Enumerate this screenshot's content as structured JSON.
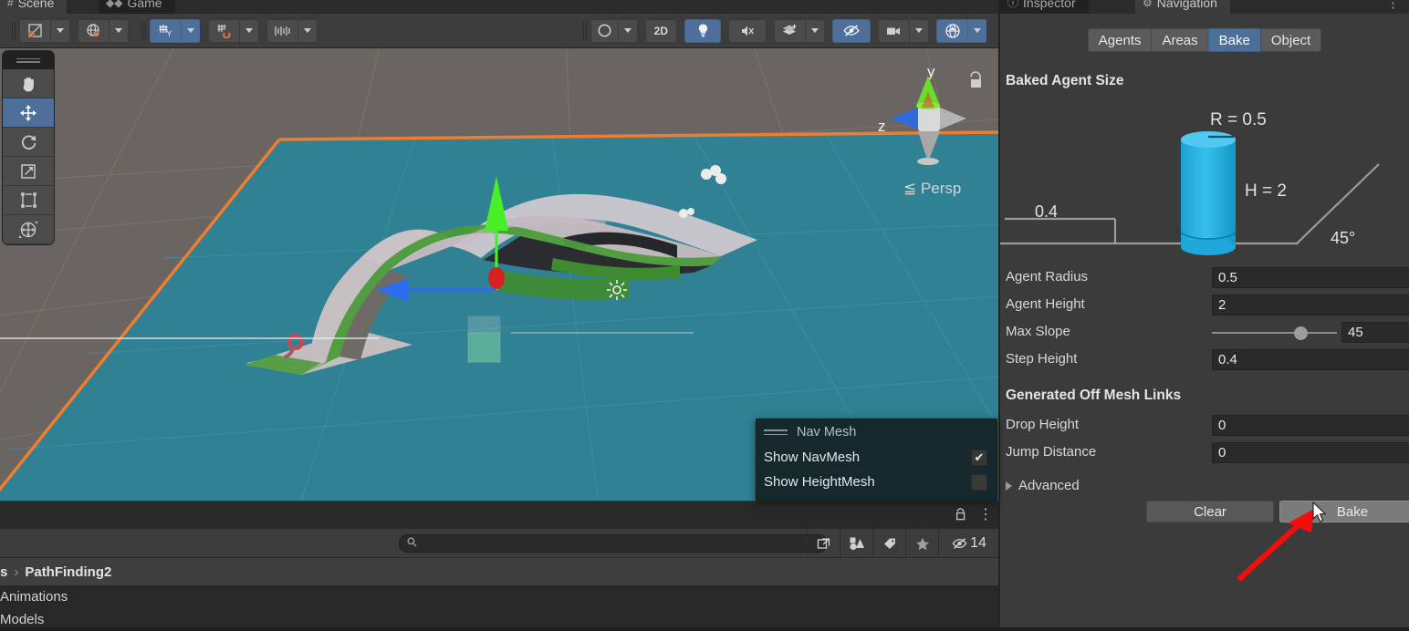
{
  "scene_panel": {
    "tabs": [
      {
        "label": "Scene",
        "icon": "grid-hash-icon",
        "active": true
      },
      {
        "label": "Game",
        "icon": "gamepad-icon",
        "active": false
      }
    ],
    "toolbar": {
      "groups": [
        {
          "items": [
            {
              "name": "pivot-rotation-icon",
              "glyph": "square-slash",
              "active": false,
              "dropdown": true
            },
            {
              "name": "pivot-center-icon",
              "glyph": "globe",
              "active": false,
              "dropdown": true
            }
          ]
        },
        {
          "items": [
            {
              "name": "grid-snapping-icon",
              "glyph": "grid-y",
              "active": true,
              "dropdown": true
            },
            {
              "name": "vertex-snapping-icon",
              "glyph": "grid-magnet",
              "active": false,
              "dropdown": true
            },
            {
              "name": "increment-snapping-icon",
              "glyph": "ruler",
              "active": false,
              "dropdown": true
            }
          ]
        }
      ],
      "right_items": [
        {
          "name": "shading-mode-icon",
          "glyph": "sphere",
          "active": false,
          "dropdown": true
        },
        {
          "name": "toggle-2d-button",
          "label": "2D",
          "active": false
        },
        {
          "name": "scene-lighting-icon",
          "glyph": "bulb",
          "active": true
        },
        {
          "name": "scene-audio-icon",
          "glyph": "speaker-mute",
          "active": false
        },
        {
          "name": "scene-fx-icon",
          "glyph": "layers-fx",
          "active": false,
          "dropdown": true
        },
        {
          "name": "scene-visibility-icon",
          "glyph": "eye-slash",
          "active": true
        },
        {
          "name": "scene-camera-icon",
          "glyph": "camera",
          "active": false,
          "dropdown": true
        },
        {
          "name": "gizmos-toggle-icon",
          "glyph": "gizmo",
          "active": true,
          "dropdown": true
        }
      ]
    },
    "tool_palette": [
      {
        "name": "hand-tool",
        "glyph": "hand",
        "active": false
      },
      {
        "name": "move-tool",
        "glyph": "move-arrows",
        "active": true
      },
      {
        "name": "rotate-tool",
        "glyph": "rotate",
        "active": false
      },
      {
        "name": "scale-tool",
        "glyph": "scale",
        "active": false
      },
      {
        "name": "rect-tool",
        "glyph": "rect",
        "active": false
      },
      {
        "name": "transform-tool",
        "glyph": "transform",
        "active": false
      }
    ],
    "gizmo": {
      "axis_y_label": "y",
      "axis_z_label": "z",
      "projection_label": "Persp",
      "projection_prefix": "≤",
      "lock_icon": "padlock-icon"
    },
    "navmesh_popup": {
      "title": "Nav Mesh",
      "rows": [
        {
          "label": "Show NavMesh",
          "checked": true
        },
        {
          "label": "Show HeightMesh",
          "checked": false
        }
      ]
    },
    "colors": {
      "navmesh_teal": "#2f8193",
      "selection_orange": "#f07d2e",
      "walkable_green": "#4c9a3a",
      "ground_gray": "#6a6560",
      "axis_y_green": "#49ef26",
      "axis_x_blue": "#2c6df0",
      "axis_z_red": "#d62121"
    }
  },
  "project_panel": {
    "lock_icon": "padlock-icon",
    "kebab_icon": "kebab-menu-icon",
    "search": {
      "placeholder": "",
      "value": "",
      "icon": "search-icon"
    },
    "toolbar_buttons": [
      {
        "name": "open-search-window-icon",
        "glyph": "open-window"
      },
      {
        "name": "filter-by-type-icon",
        "glyph": "shapes"
      },
      {
        "name": "filter-by-label-icon",
        "glyph": "tag"
      },
      {
        "name": "favorites-icon",
        "glyph": "star"
      },
      {
        "name": "hidden-count-icon",
        "glyph": "eye-slash",
        "count": "14"
      }
    ],
    "breadcrumb": [
      "s",
      "PathFinding2"
    ],
    "breadcrumb_separator": "›",
    "items": [
      "Animations",
      "Models"
    ]
  },
  "inspector": {
    "tabs": [
      {
        "label": "Inspector",
        "icon": "info-circle-icon",
        "active": false
      },
      {
        "label": "Navigation",
        "icon": "navigation-icon",
        "active": true
      }
    ],
    "kebab_icon": "kebab-menu-icon",
    "mode_tabs": [
      {
        "label": "Agents",
        "selected": false
      },
      {
        "label": "Areas",
        "selected": false
      },
      {
        "label": "Bake",
        "selected": true
      },
      {
        "label": "Object",
        "selected": false
      }
    ],
    "baked_agent_size": {
      "title": "Baked Agent Size",
      "diagram": {
        "radius_label": "R = 0.5",
        "height_label": "H = 2",
        "step_label": "0.4",
        "slope_label": "45°",
        "cylinder_color": "#29b0e0"
      },
      "properties": [
        {
          "label": "Agent Radius",
          "value": "0.5",
          "type": "field"
        },
        {
          "label": "Agent Height",
          "value": "2",
          "type": "field"
        },
        {
          "label": "Max Slope",
          "value": "45",
          "type": "slider",
          "slider_min": 0,
          "slider_max": 60,
          "slider_pct": 66
        },
        {
          "label": "Step Height",
          "value": "0.4",
          "type": "field"
        }
      ]
    },
    "generated_off_mesh_links": {
      "title": "Generated Off Mesh Links",
      "properties": [
        {
          "label": "Drop Height",
          "value": "0",
          "type": "field"
        },
        {
          "label": "Jump Distance",
          "value": "0",
          "type": "field"
        }
      ]
    },
    "advanced": {
      "label": "Advanced",
      "expanded": false
    },
    "buttons": [
      {
        "name": "clear-button",
        "label": "Clear"
      },
      {
        "name": "bake-button",
        "label": "Bake"
      }
    ]
  }
}
